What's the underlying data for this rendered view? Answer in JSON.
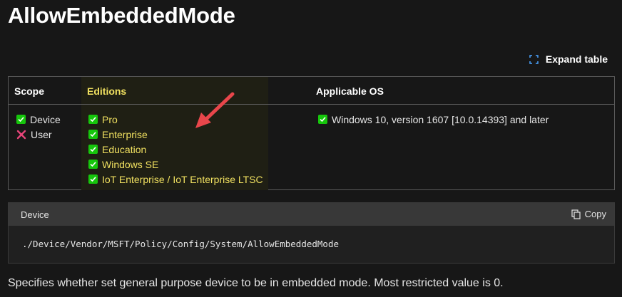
{
  "title": "AllowEmbeddedMode",
  "expand_label": "Expand table",
  "table": {
    "headers": {
      "scope": "Scope",
      "editions": "Editions",
      "os": "Applicable OS"
    },
    "scope": [
      {
        "label": "Device",
        "status": "check"
      },
      {
        "label": "User",
        "status": "cross"
      }
    ],
    "editions": [
      "Pro",
      "Enterprise",
      "Education",
      "Windows SE",
      "IoT Enterprise / IoT Enterprise LTSC"
    ],
    "os": [
      "Windows 10, version 1607 [10.0.14393] and later"
    ]
  },
  "code": {
    "label": "Device",
    "copy_label": "Copy",
    "path": "./Device/Vendor/MSFT/Policy/Config/System/AllowEmbeddedMode"
  },
  "description": "Specifies whether set general purpose device to be in embedded mode. Most restricted value is 0.",
  "colors": {
    "check": "#16c60c",
    "cross": "#e8457a",
    "editions_highlight": "#f0e060",
    "arrow": "#e8464b"
  }
}
